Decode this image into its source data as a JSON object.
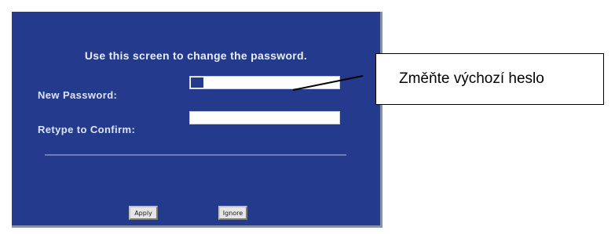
{
  "dialog": {
    "instruction": "Use this screen to change the password.",
    "new_password_label": "New Password:",
    "new_password_value": "",
    "confirm_label": "Retype to Confirm:",
    "confirm_value": "",
    "apply_label": "Apply",
    "ignore_label": "Ignore"
  },
  "callout": {
    "text": "Změňte výchozí heslo"
  },
  "colors": {
    "panel_background": "#243a8c",
    "panel_text": "#e9edf8",
    "field_background": "#ffffff",
    "button_face": "#e6e6e6"
  }
}
